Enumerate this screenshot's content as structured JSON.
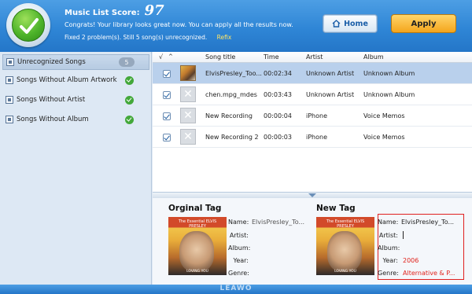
{
  "header": {
    "score_label": "Music List Score:",
    "score_value": "97",
    "message": "Congrats! Your library looks great now. You can apply all the results now.",
    "status": "Fixed 2 problem(s). Still 5 song(s) unrecognized.",
    "refix_label": "Refix",
    "home_label": "Home",
    "apply_label": "Apply"
  },
  "sidebar": {
    "items": [
      {
        "label": "Unrecognized Songs",
        "count": "5",
        "icon": "music-icon",
        "active": true
      },
      {
        "label": "Songs Without Album Artwork",
        "icon": "artwork-icon",
        "status": "ok"
      },
      {
        "label": "Songs Without Artist",
        "icon": "artist-icon",
        "status": "ok"
      },
      {
        "label": "Songs Without Album",
        "icon": "album-icon",
        "status": "ok"
      }
    ]
  },
  "table": {
    "check_header": "√",
    "sort_indicator": "^",
    "columns": [
      "Song title",
      "Time",
      "Artist",
      "Album"
    ],
    "rows": [
      {
        "checked": true,
        "title": "ElvisPresley_Too...",
        "time": "00:02:34",
        "artist": "Unknown Artist",
        "album": "Unknown Album",
        "has_art": true
      },
      {
        "checked": true,
        "title": "chen.mpg_mdes",
        "time": "00:03:43",
        "artist": "Unknown Artist",
        "album": "Unknown Album",
        "has_art": false
      },
      {
        "checked": true,
        "title": "New Recording",
        "time": "00:00:04",
        "artist": "iPhone",
        "album": "Voice Memos",
        "has_art": false
      },
      {
        "checked": true,
        "title": "New Recording 2",
        "time": "00:00:03",
        "artist": "iPhone",
        "album": "Voice Memos",
        "has_art": false
      }
    ]
  },
  "original_tag": {
    "heading": "Orginal Tag",
    "labels": {
      "name": "Name:",
      "artist": "Artist:",
      "album": "Album:",
      "year": "Year:",
      "genre": "Genre:"
    },
    "values": {
      "name": "ElvisPresley_To...",
      "artist": "",
      "album": "",
      "year": "",
      "genre": ""
    },
    "cover_title": "The Essential ELVIS PRESLEY",
    "cover_subtitle": "LOVING YOU"
  },
  "new_tag": {
    "heading": "New Tag",
    "labels": {
      "name": "Name:",
      "artist": "Artist:",
      "album": "Album:",
      "year": "Year:",
      "genre": "Genre:"
    },
    "values": {
      "name": "ElvisPresley_To...",
      "artist": "",
      "album": "",
      "year": "2006",
      "genre": "Alternative & P..."
    },
    "cover_title": "The Essential ELVIS PRESLEY",
    "cover_subtitle": "LOVING YOU"
  },
  "footer": {
    "logo": "LEAWO"
  },
  "colors": {
    "accent_blue": "#2f86d6",
    "apply_orange": "#f4a51c",
    "ok_green": "#43a83a",
    "highlight_red": "#e02020"
  }
}
